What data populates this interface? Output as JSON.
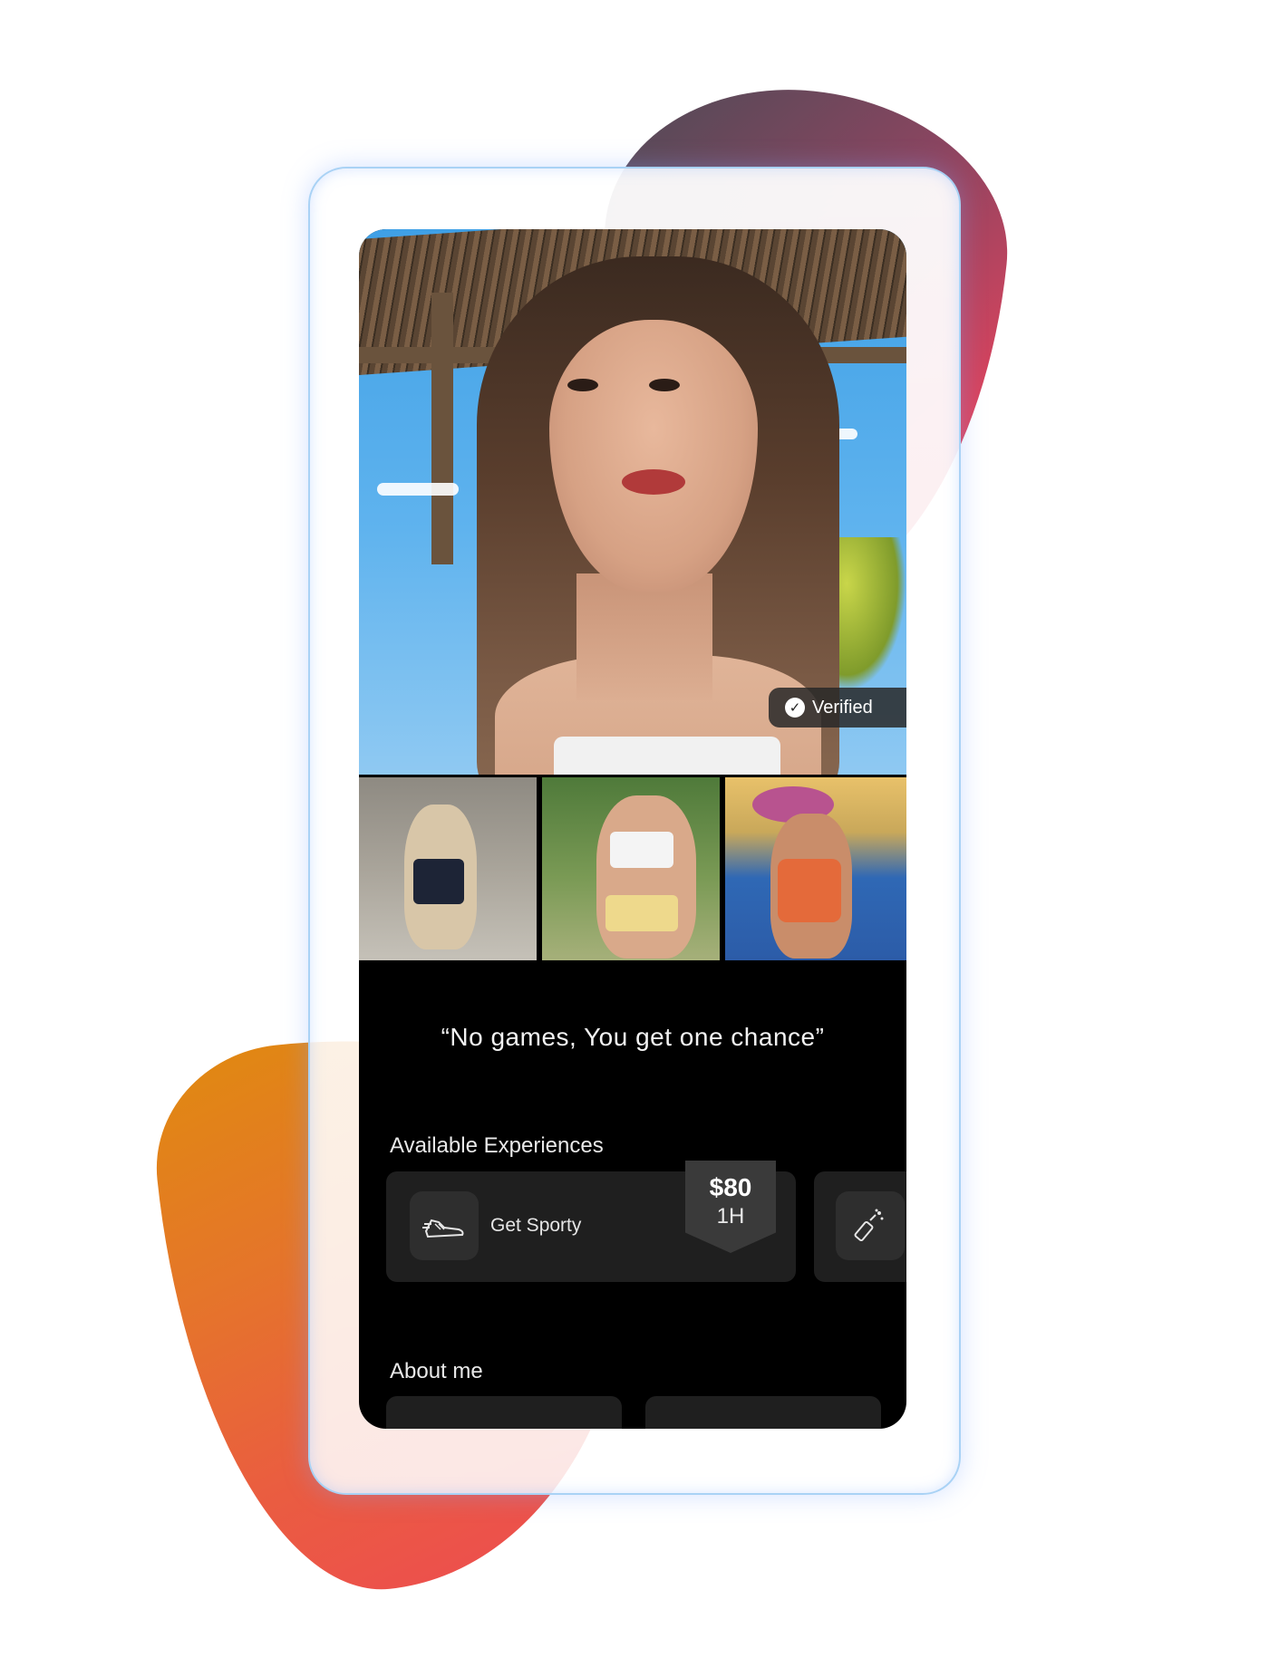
{
  "profile": {
    "verified_label": "Verified",
    "quote": "“No games, You get one chance”"
  },
  "experiences": {
    "title": "Available Experiences",
    "items": [
      {
        "label": "Get Sporty",
        "price": "$80",
        "duration": "1H",
        "icon": "sneaker-icon"
      },
      {
        "label": "",
        "icon": "champagne-icon"
      }
    ]
  },
  "about": {
    "title": "About me"
  },
  "colors": {
    "screen_bg": "#000000",
    "card_bg": "#1f1f1f",
    "badge_bg": "#3a3a3a",
    "frame_border": "#a9d2f5",
    "blob_top": "#f0455e",
    "blob_bottom": "#e08a10"
  }
}
